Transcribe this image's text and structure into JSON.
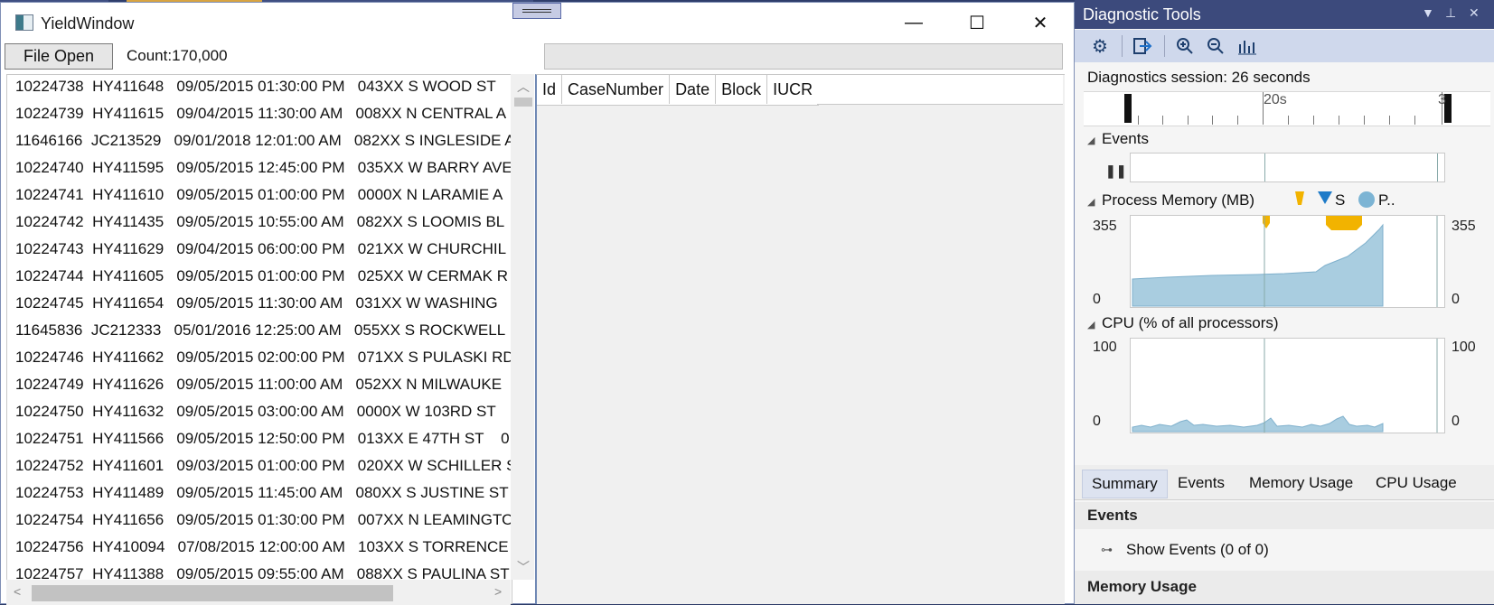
{
  "yield_window": {
    "title": "YieldWindow",
    "buttons": {
      "minimize": "—",
      "maximize": "☐",
      "close": "✕"
    },
    "file_open_label": "File Open",
    "count_text": "Count:170,000",
    "rows": [
      "10224738  HY411648   09/05/2015 01:30:00 PM   043XX S WOOD ST",
      "10224739  HY411615   09/04/2015 11:30:00 AM   008XX N CENTRAL A",
      "11646166  JC213529   09/01/2018 12:01:00 AM   082XX S INGLESIDE A",
      "10224740  HY411595   09/05/2015 12:45:00 PM   035XX W BARRY AVE",
      "10224741  HY411610   09/05/2015 01:00:00 PM   0000X N LARAMIE A",
      "10224742  HY411435   09/05/2015 10:55:00 AM   082XX S LOOMIS BL",
      "10224743  HY411629   09/04/2015 06:00:00 PM   021XX W CHURCHIL",
      "10224744  HY411605   09/05/2015 01:00:00 PM   025XX W CERMAK R",
      "10224745  HY411654   09/05/2015 11:30:00 AM   031XX W WASHING",
      "11645836  JC212333   05/01/2016 12:25:00 AM   055XX S ROCKWELL",
      "10224746  HY411662   09/05/2015 02:00:00 PM   071XX S PULASKI RD",
      "10224749  HY411626   09/05/2015 11:00:00 AM   052XX N MILWAUKE",
      "10224750  HY411632   09/05/2015 03:00:00 AM   0000X W 103RD ST",
      "10224751  HY411566   09/05/2015 12:50:00 PM   013XX E 47TH ST    0",
      "10224752  HY411601   09/03/2015 01:00:00 PM   020XX W SCHILLER S",
      "10224753  HY411489   09/05/2015 11:45:00 AM   080XX S JUSTINE ST",
      "10224754  HY411656   09/05/2015 01:30:00 PM   007XX N LEAMINGTO",
      "10224756  HY410094   07/08/2015 12:00:00 AM   103XX S TORRENCE",
      "10224757  HY411388   09/05/2015 09:55:00 AM   088XX S PAULINA ST"
    ],
    "grid_columns": [
      "Id",
      "CaseNumber",
      "Date",
      "Block",
      "IUCR"
    ]
  },
  "diagnostic_tools": {
    "title": "Diagnostic Tools",
    "title_buttons": {
      "menu": "▼",
      "pin": "⊥",
      "close": "✕"
    },
    "toolbar_icons": [
      "gear-icon",
      "export-icon",
      "zoom-in-icon",
      "zoom-out-icon",
      "reset-zoom-icon"
    ],
    "session_text": "Diagnostics session: 26 seconds",
    "timeline": {
      "label": "20s",
      "label_end": "3"
    },
    "events_section": "Events",
    "process_memory": {
      "title": "Process Memory (MB)",
      "legend_s": "S",
      "legend_p": "P..",
      "y_max": "355",
      "y_min": "0"
    },
    "cpu": {
      "title": "CPU (% of all processors)",
      "y_max": "100",
      "y_min": "0"
    },
    "tabs": [
      "Summary",
      "Events",
      "Memory Usage",
      "CPU Usage"
    ],
    "summary": {
      "events_header": "Events",
      "show_events": "Show Events (0 of 0)",
      "memory_header": "Memory Usage"
    },
    "colors": {
      "memory_fill": "#a9cde0",
      "gc_marker": "#f2b300",
      "snapshot": "#1e7bc8",
      "accent": "#3c4a7c"
    }
  }
}
